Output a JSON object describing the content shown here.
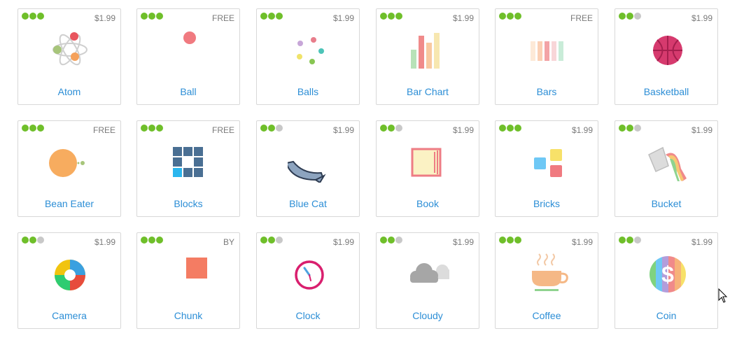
{
  "cards": [
    {
      "name": "Atom",
      "price": "$1.99"
    },
    {
      "name": "Ball",
      "price": "FREE"
    },
    {
      "name": "Balls",
      "price": "$1.99"
    },
    {
      "name": "Bar Chart",
      "price": "$1.99"
    },
    {
      "name": "Bars",
      "price": "FREE"
    },
    {
      "name": "Basketball",
      "price": "$1.99"
    },
    {
      "name": "Bean Eater",
      "price": "FREE"
    },
    {
      "name": "Blocks",
      "price": "FREE"
    },
    {
      "name": "Blue Cat",
      "price": "$1.99"
    },
    {
      "name": "Book",
      "price": "$1.99"
    },
    {
      "name": "Bricks",
      "price": "$1.99"
    },
    {
      "name": "Bucket",
      "price": "$1.99"
    },
    {
      "name": "Camera",
      "price": "$1.99"
    },
    {
      "name": "Chunk",
      "price": "BY"
    },
    {
      "name": "Clock",
      "price": "$1.99"
    },
    {
      "name": "Cloudy",
      "price": "$1.99"
    },
    {
      "name": "Coffee",
      "price": "$1.99"
    },
    {
      "name": "Coin",
      "price": "$1.99"
    }
  ],
  "colors": {
    "label": "#2c8ed6",
    "badge_on": "#6fbf2a",
    "badge_off": "#c8c8c8"
  }
}
